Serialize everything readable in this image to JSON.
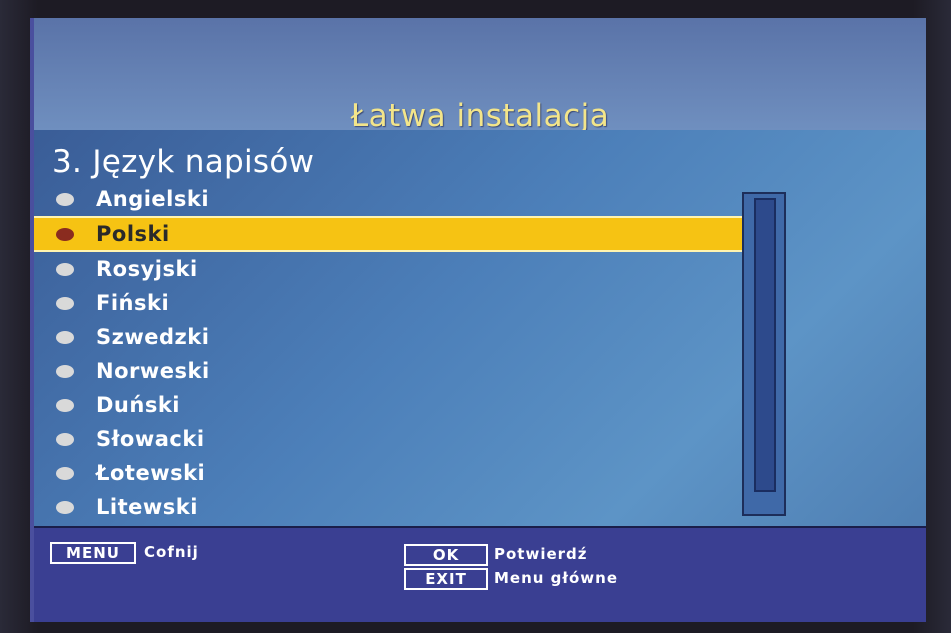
{
  "screen": {
    "title": "Łatwa instalacja",
    "section_title": "3. Język napisów"
  },
  "languages": [
    {
      "label": "Angielski",
      "selected": false
    },
    {
      "label": "Polski",
      "selected": true
    },
    {
      "label": "Rosyjski",
      "selected": false
    },
    {
      "label": "Fiński",
      "selected": false
    },
    {
      "label": "Szwedzki",
      "selected": false
    },
    {
      "label": "Norweski",
      "selected": false
    },
    {
      "label": "Duński",
      "selected": false
    },
    {
      "label": "Słowacki",
      "selected": false
    },
    {
      "label": "Łotewski",
      "selected": false
    },
    {
      "label": "Litewski",
      "selected": false
    }
  ],
  "footer": {
    "menu_key": "MENU",
    "menu_label": "Cofnij",
    "ok_key": "OK",
    "ok_label": "Potwierdź",
    "exit_key": "EXIT",
    "exit_label": "Menu główne"
  },
  "colors": {
    "highlight": "#f6c313",
    "title_text": "#f3e58a",
    "selected_bullet": "#8a2c1f",
    "bullet": "#d9d9d9"
  }
}
